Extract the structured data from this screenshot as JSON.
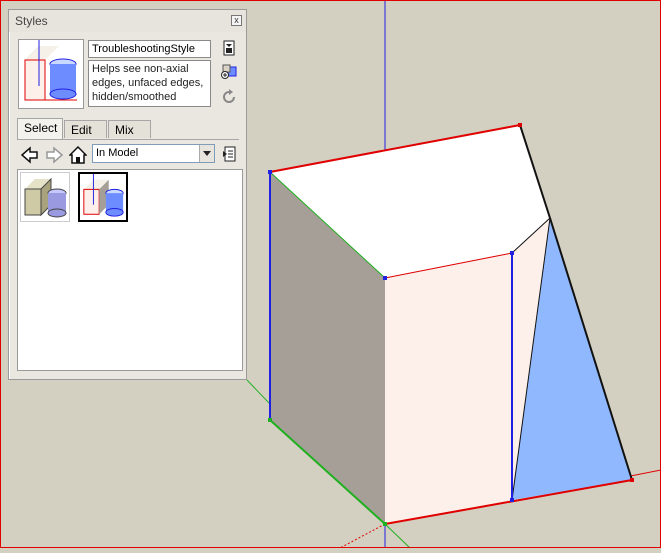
{
  "window": {
    "title": "Styles",
    "close_glyph": "x"
  },
  "style": {
    "name": "TroubleshootingStyle",
    "description": "Helps see non-axial edges, unfaced edges, hidden/smoothed"
  },
  "tabs": [
    {
      "label": "Select"
    },
    {
      "label": "Edit"
    },
    {
      "label": "Mix"
    }
  ],
  "collection": {
    "selected": "In Model"
  },
  "icons": {
    "back": "back-arrow-icon",
    "forward": "forward-arrow-icon",
    "home": "home-icon",
    "details": "details-icon",
    "create": "create-style-icon",
    "update": "update-style-icon",
    "refresh": "refresh-icon"
  },
  "colors": {
    "red_axis": "#e00000",
    "green_axis": "#1fb01f",
    "blue_axis": "#2020e0",
    "canvas": "#d4d0c1",
    "shaded_face": "#a69f98",
    "light_face": "#fdf0ea",
    "blue_face": "#90b8ff"
  }
}
